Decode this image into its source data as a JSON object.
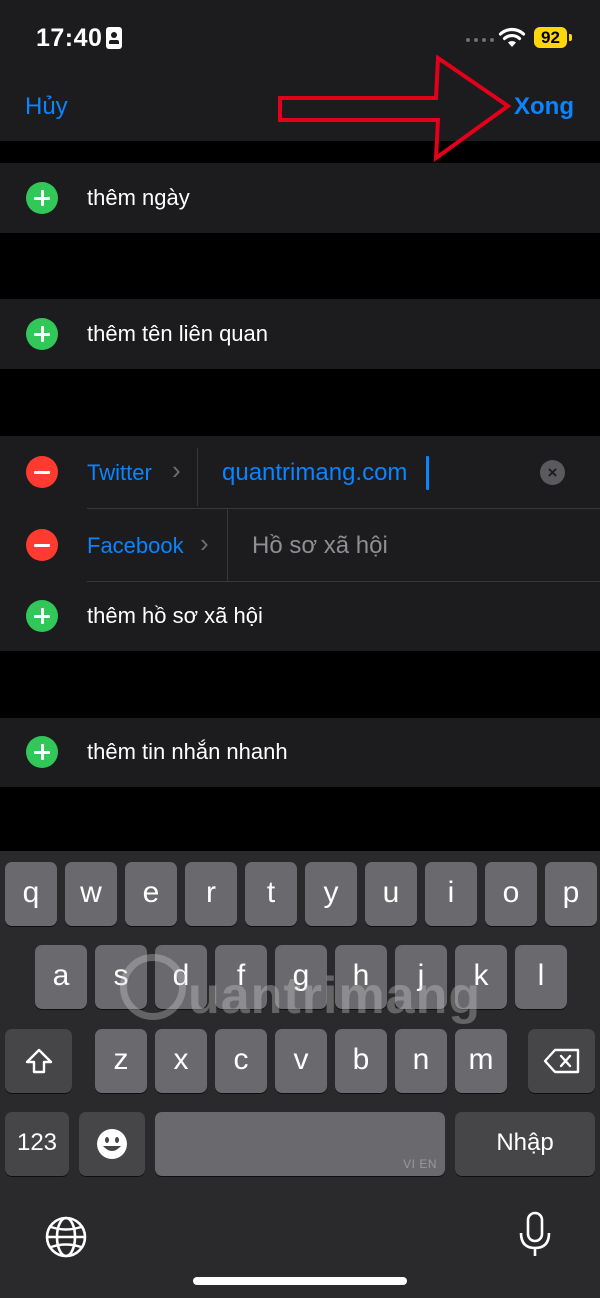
{
  "status": {
    "time": "17:40",
    "battery": "92"
  },
  "nav": {
    "cancel": "Hủy",
    "done": "Xong"
  },
  "rows": {
    "add_date": "thêm ngày",
    "add_related": "thêm tên liên quan",
    "add_social": "thêm hồ sơ xã hội",
    "add_im": "thêm tin nhắn nhanh"
  },
  "social": [
    {
      "type": "Twitter",
      "value": "quantrimang.com"
    },
    {
      "type": "Facebook",
      "placeholder": "Hồ sơ xã hội"
    }
  ],
  "keyboard": {
    "row1": [
      "q",
      "w",
      "e",
      "r",
      "t",
      "y",
      "u",
      "i",
      "o",
      "p"
    ],
    "row2": [
      "a",
      "s",
      "d",
      "f",
      "g",
      "h",
      "j",
      "k",
      "l"
    ],
    "row3": [
      "z",
      "x",
      "c",
      "v",
      "b",
      "n",
      "m"
    ],
    "numbers": "123",
    "return": "Nhập",
    "space_hint": "VI EN"
  },
  "watermark": "uantrimang",
  "colors": {
    "accent": "#0a84ff",
    "add": "#32c759",
    "remove": "#ff3b30",
    "arrow": "#e3001b"
  }
}
